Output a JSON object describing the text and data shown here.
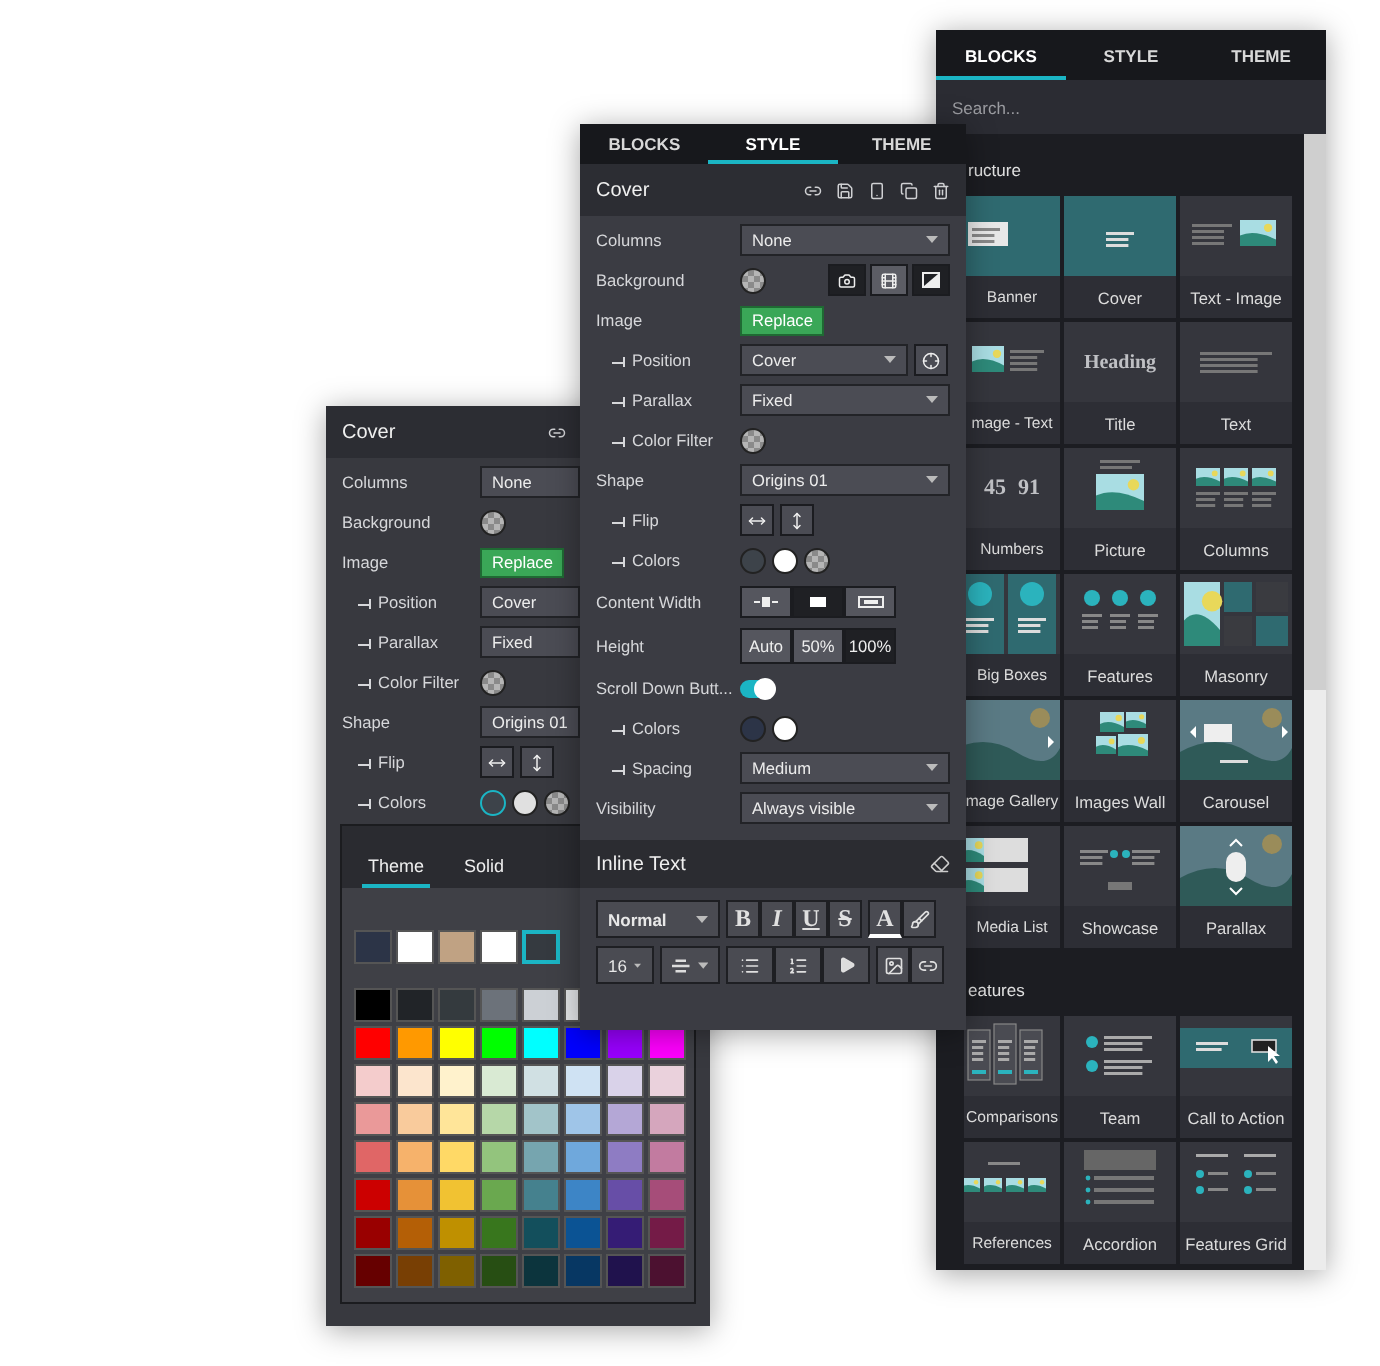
{
  "style_panel": {
    "tabs": [
      {
        "label": "BLOCKS",
        "selected": false
      },
      {
        "label": "STYLE",
        "selected": true
      },
      {
        "label": "THEME",
        "selected": false
      }
    ],
    "title": "Cover",
    "rows": [
      {
        "kind": "select",
        "label": "Columns",
        "value": "None"
      },
      {
        "kind": "color_media",
        "label": "Background",
        "swatches": [
          {
            "kind": "transparent",
            "selected": false
          }
        ],
        "media": [
          {
            "kind": "image",
            "selected": false
          },
          {
            "kind": "video",
            "selected": true
          },
          {
            "kind": "gradient",
            "selected": false
          }
        ]
      },
      {
        "kind": "button",
        "label": "Image",
        "value": "Replace",
        "children": [
          {
            "kind": "select_button",
            "label": "Position",
            "value": "Cover"
          },
          {
            "kind": "select",
            "label": "Parallax",
            "value": "Fixed"
          },
          {
            "kind": "color",
            "label": "Color Filter",
            "swatches": [
              {
                "kind": "transparent",
                "selected": false
              }
            ]
          }
        ]
      },
      {
        "kind": "select",
        "label": "Shape",
        "value": "Origins 01",
        "children": [
          {
            "kind": "flip",
            "label": "Flip"
          },
          {
            "kind": "color",
            "label": "Colors",
            "swatches": [
              {
                "kind": "solid",
                "color": "#3d434a",
                "selected": false
              },
              {
                "kind": "solid",
                "color": "#ffffff",
                "selected": false
              },
              {
                "kind": "transparent",
                "selected": false
              }
            ]
          }
        ]
      },
      {
        "kind": "icon_options",
        "label": "Content Width",
        "options": [
          {
            "kind": "narrow",
            "selected": false
          },
          {
            "kind": "medium",
            "selected": true
          },
          {
            "kind": "wide",
            "selected": false
          }
        ]
      },
      {
        "kind": "text_options",
        "label": "Height",
        "options": [
          {
            "label": "Auto",
            "selected": false
          },
          {
            "label": "50%",
            "selected": false
          },
          {
            "label": "100%",
            "selected": true
          }
        ]
      },
      {
        "kind": "toggle",
        "label": "Scroll Down Butt...",
        "on": true,
        "children": [
          {
            "kind": "color",
            "label": "Colors",
            "swatches": [
              {
                "kind": "solid",
                "color": "#2c3447",
                "selected": false
              },
              {
                "kind": "solid",
                "color": "#ffffff",
                "selected": false
              }
            ]
          },
          {
            "kind": "select",
            "label": "Spacing",
            "value": "Medium"
          }
        ]
      },
      {
        "kind": "select",
        "label": "Visibility",
        "value": "Always visible"
      }
    ],
    "inline_text": {
      "title": "Inline Text",
      "format": "Normal",
      "size": "16",
      "styles": [
        {
          "label": "B",
          "kind": "bold"
        },
        {
          "label": "I",
          "kind": "italic"
        },
        {
          "label": "U",
          "kind": "underline"
        },
        {
          "label": "S",
          "kind": "strike"
        },
        {
          "label": "A",
          "kind": "color"
        }
      ]
    }
  },
  "back_panel": {
    "title": "Cover",
    "rows": [
      {
        "kind": "select",
        "label": "Columns",
        "value": "None"
      },
      {
        "kind": "color",
        "label": "Background",
        "swatches": [
          {
            "kind": "transparent",
            "selected": false
          }
        ]
      },
      {
        "kind": "button",
        "label": "Image",
        "value": "Replace",
        "children": [
          {
            "kind": "select",
            "label": "Position",
            "value": "Cover"
          },
          {
            "kind": "select",
            "label": "Parallax",
            "value": "Fixed"
          },
          {
            "kind": "color",
            "label": "Color Filter",
            "swatches": [
              {
                "kind": "transparent",
                "selected": false
              }
            ]
          }
        ]
      },
      {
        "kind": "select",
        "label": "Shape",
        "value": "Origins 01",
        "children": [
          {
            "kind": "flip",
            "label": "Flip"
          },
          {
            "kind": "color",
            "label": "Colors",
            "swatches": [
              {
                "kind": "solid",
                "color": "#3d434a",
                "selected": true
              },
              {
                "kind": "solid",
                "color": "#e0e0e0",
                "selected": false
              },
              {
                "kind": "transparent",
                "selected": false
              }
            ]
          }
        ]
      }
    ],
    "color_picker": {
      "tabs": [
        {
          "label": "Theme",
          "selected": true
        },
        {
          "label": "Solid",
          "selected": false
        }
      ],
      "theme_colors": [
        {
          "color": "#2c3447",
          "selected": false
        },
        {
          "color": "#ffffff",
          "selected": false
        },
        {
          "color": "#c0a283",
          "selected": false
        },
        {
          "color": "#ffffff",
          "selected": false
        },
        {
          "color": "#353a40",
          "selected": true
        }
      ],
      "palette": [
        [
          {
            "color": "#000000"
          },
          {
            "color": "#212428"
          },
          {
            "color": "#343a3e"
          },
          {
            "color": "#6c727a"
          },
          {
            "color": "#ccd0d5"
          },
          {
            "color": "#e2e4e6"
          }
        ],
        [
          {
            "color": "#ff0000"
          },
          {
            "color": "#ff9900"
          },
          {
            "color": "#ffff00"
          },
          {
            "color": "#00ff00"
          },
          {
            "color": "#00ffff"
          },
          {
            "color": "#0000ff"
          },
          {
            "color": "#9900ff"
          },
          {
            "color": "#ff00ff"
          }
        ],
        [
          {
            "color": "#f4cccc"
          },
          {
            "color": "#fce5cd"
          },
          {
            "color": "#fff2cc"
          },
          {
            "color": "#d9ead3"
          },
          {
            "color": "#d0e0e3"
          },
          {
            "color": "#cfe2f3"
          },
          {
            "color": "#d9d2e9"
          },
          {
            "color": "#ead1dc"
          }
        ],
        [
          {
            "color": "#ea9999"
          },
          {
            "color": "#f9cb9c"
          },
          {
            "color": "#ffe599"
          },
          {
            "color": "#b6d7a8"
          },
          {
            "color": "#a2c4c9"
          },
          {
            "color": "#9fc5e8"
          },
          {
            "color": "#b4a7d6"
          },
          {
            "color": "#d5a6bd"
          }
        ],
        [
          {
            "color": "#e06666"
          },
          {
            "color": "#f6b26b"
          },
          {
            "color": "#ffd966"
          },
          {
            "color": "#93c47d"
          },
          {
            "color": "#76a5af"
          },
          {
            "color": "#6fa8dc"
          },
          {
            "color": "#8e7cc3"
          },
          {
            "color": "#c27ba0"
          }
        ],
        [
          {
            "color": "#cc0000"
          },
          {
            "color": "#e69138"
          },
          {
            "color": "#f1c232"
          },
          {
            "color": "#6aa84f"
          },
          {
            "color": "#45818e"
          },
          {
            "color": "#3d85c6"
          },
          {
            "color": "#674ea7"
          },
          {
            "color": "#a64d79"
          }
        ],
        [
          {
            "color": "#990000"
          },
          {
            "color": "#b45f06"
          },
          {
            "color": "#bf9000"
          },
          {
            "color": "#38761d"
          },
          {
            "color": "#134f5c"
          },
          {
            "color": "#0b5394"
          },
          {
            "color": "#351c75"
          },
          {
            "color": "#741b47"
          }
        ],
        [
          {
            "color": "#660000"
          },
          {
            "color": "#783f04"
          },
          {
            "color": "#7f6000"
          },
          {
            "color": "#274e13"
          },
          {
            "color": "#0c343d"
          },
          {
            "color": "#073763"
          },
          {
            "color": "#20124d"
          },
          {
            "color": "#4c1130"
          }
        ]
      ]
    }
  },
  "blocks_panel": {
    "tabs": [
      {
        "label": "BLOCKS",
        "selected": true
      },
      {
        "label": "STYLE",
        "selected": false
      },
      {
        "label": "THEME",
        "selected": false
      }
    ],
    "search": {
      "placeholder": "Search..."
    },
    "sections": [
      {
        "title": "ructure",
        "blocks": [
          {
            "label": "Banner"
          },
          {
            "label": "Cover"
          },
          {
            "label": "Text - Image"
          },
          {
            "label": "mage - Text"
          },
          {
            "label": "Title",
            "preview": [
              "Heading"
            ]
          },
          {
            "label": "Text"
          },
          {
            "label": "Numbers",
            "preview": [
              "45",
              "91"
            ]
          },
          {
            "label": "Picture"
          },
          {
            "label": "Columns"
          },
          {
            "label": "Big Boxes"
          },
          {
            "label": "Features"
          },
          {
            "label": "Masonry"
          },
          {
            "label": "mage Gallery"
          },
          {
            "label": "Images Wall"
          },
          {
            "label": "Carousel"
          },
          {
            "label": "Media List"
          },
          {
            "label": "Showcase"
          },
          {
            "label": "Parallax"
          }
        ]
      },
      {
        "title": "eatures",
        "blocks": [
          {
            "label": "Comparisons"
          },
          {
            "label": "Team"
          },
          {
            "label": "Call to Action"
          },
          {
            "label": "References"
          },
          {
            "label": "Accordion"
          },
          {
            "label": "Features Grid"
          }
        ]
      }
    ]
  }
}
